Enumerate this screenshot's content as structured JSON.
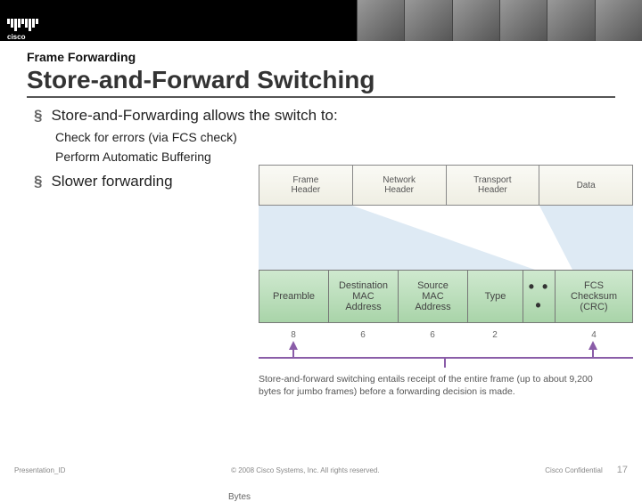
{
  "logo": {
    "name": "cisco"
  },
  "header": {
    "kicker": "Frame Forwarding",
    "title": "Store-and-Forward Switching"
  },
  "bullets": {
    "b1": "Store-and-Forwarding allows the switch to:",
    "b1a": "Check for errors (via FCS check)",
    "b1b": "Perform Automatic Buffering",
    "b2": "Slower forwarding"
  },
  "layers": {
    "c0a": "Frame",
    "c0b": "Header",
    "c1a": "Network",
    "c1b": "Header",
    "c2a": "Transport",
    "c2b": "Header",
    "c3a": "Data"
  },
  "frame": {
    "c0": "Preamble",
    "c1a": "Destination",
    "c1b": "MAC",
    "c1c": "Address",
    "c2a": "Source",
    "c2b": "MAC",
    "c2c": "Address",
    "c3": "Type",
    "c4": "• • •",
    "c5a": "FCS",
    "c5b": "Checksum",
    "c5c": "(CRC)"
  },
  "bytes": {
    "label": "Bytes",
    "v0": "8",
    "v1": "6",
    "v2": "6",
    "v3": "2",
    "v4": "",
    "v5": "4"
  },
  "caption": {
    "l1": "Store-and-forward switching entails receipt of the entire frame (up to about 9,200",
    "l2": "bytes for jumbo frames) before a forwarding decision is made."
  },
  "footer": {
    "pid": "Presentation_ID",
    "copy": "© 2008 Cisco Systems, Inc. All rights reserved.",
    "conf": "Cisco Confidential",
    "page": "17"
  }
}
